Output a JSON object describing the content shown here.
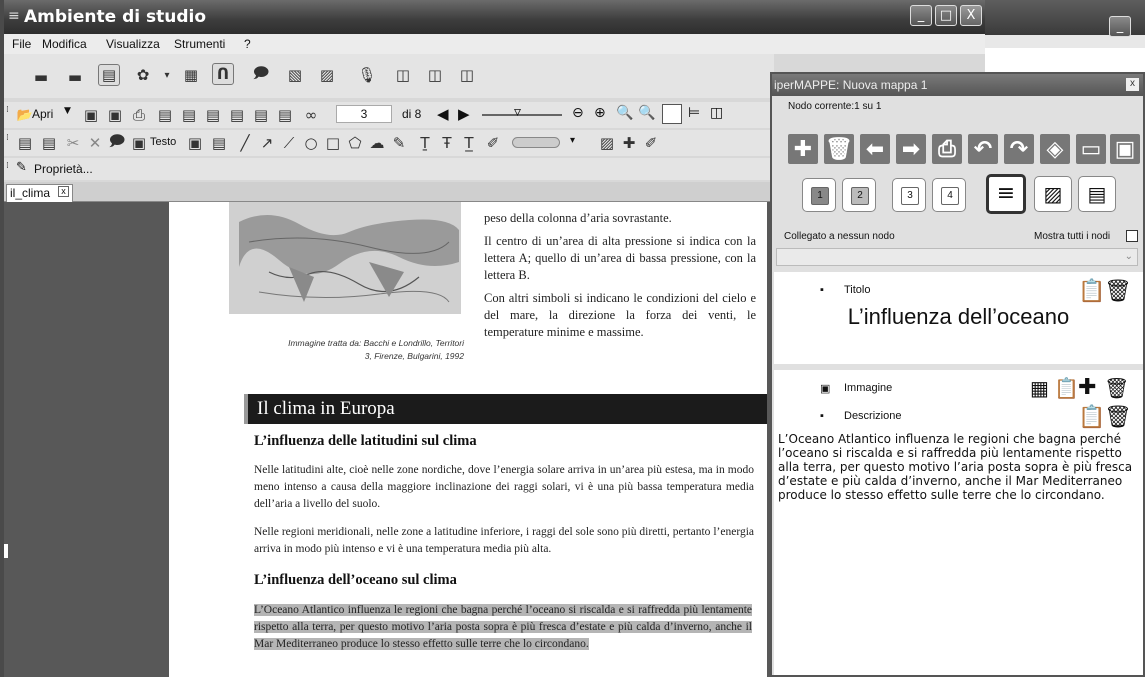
{
  "window": {
    "title": "Ambiente di studio",
    "minimize": "_",
    "maximize": "□",
    "close": "X"
  },
  "menu": [
    "File",
    "Modifica",
    "Visualizza",
    "Strumenti",
    "?"
  ],
  "toolbar": {
    "open_label": "Apri",
    "page_current": "3",
    "page_total": "di 8",
    "text_label": "Testo",
    "properties_label": "Proprietà..."
  },
  "tab": {
    "label": "il_clima",
    "close": "x"
  },
  "document": {
    "paragraph_top": [
      "peso della colonna d’aria sovrastante.",
      "Il centro di un’area di alta pressione si indica con la lettera A; quello di un’area di bassa pressione, con la lettera B.",
      "Con altri simboli si indicano le condizioni del cielo e del mare, la direzione la forza dei venti, le temperature minime e massime."
    ],
    "image_caption": "Immagine tratta da: Bacchi e Londrillo, Territori 3, Firenze, Bulgarini, 1992",
    "section_title": "Il clima in Europa",
    "heading_latitudes": "L’influenza delle latitudini sul clima",
    "para_1": "Nelle latitudini alte, cioè nelle zone nordiche, dove l’energia solare arriva in un’area più estesa, ma in modo meno intenso a causa della maggiore inclinazione dei raggi solari, vi è una più bassa temperatura media dell’aria a livello del suolo.",
    "para_2": "Nelle regioni meridionali, nelle zone a latitudine inferiore, i raggi del sole sono più diretti, pertanto l’energia arriva in modo più intenso e vi è una temperatura media più alta.",
    "heading_ocean": "L’influenza dell’oceano sul clima",
    "highlighted": "L’Oceano Atlantico influenza le regioni che bagna perché l’oceano si riscalda e si raffredda più lentamente rispetto alla terra, per questo motivo l’aria posta sopra è più fresca d’estate e più calda d’inverno, anche il Mar Mediterraneo produce lo stesso effetto sulle terre che lo circondano."
  },
  "panel": {
    "title": "iperMAPPE: Nuova mappa 1",
    "close": "x",
    "current_node": "Nodo corrente:1 su 1",
    "levels": [
      "1",
      "2",
      "3",
      "4"
    ],
    "linked": "Collegato a nessun nodo",
    "show_all": "Mostra tutti i nodi",
    "title_label": "Titolo",
    "title_value": "L’influenza dell’oceano",
    "image_label": "Immagine",
    "description_label": "Descrizione",
    "description_value": "L’Oceano Atlantico influenza le regioni che bagna perché l’oceano si riscalda e si raffredda più lentamente rispetto alla terra, per questo motivo l’aria posta sopra è più fresca d’estate e più calda d’inverno, anche il Mar Mediterraneo produce lo stesso effetto sulle terre che lo circondano."
  }
}
